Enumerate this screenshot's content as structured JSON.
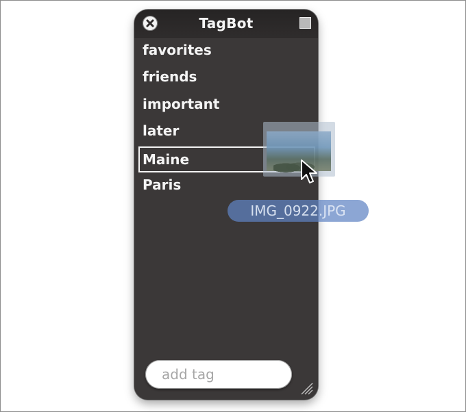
{
  "window": {
    "title": "TagBot",
    "tags": [
      "favorites",
      "friends",
      "important",
      "later",
      "Maine",
      "Paris"
    ],
    "highlighted_tag_index": 4,
    "add_tag_placeholder": "add tag"
  },
  "drag": {
    "file_name": "IMG_0922.JPG"
  },
  "icons": {
    "close": "close-icon",
    "zoom": "zoom-icon",
    "resize": "resize-grip-icon",
    "cursor": "arrow-cursor-icon"
  },
  "colors": {
    "hud_background": "#3b3838",
    "text": "#f4f4f4",
    "drag_label": "#6084c4"
  }
}
